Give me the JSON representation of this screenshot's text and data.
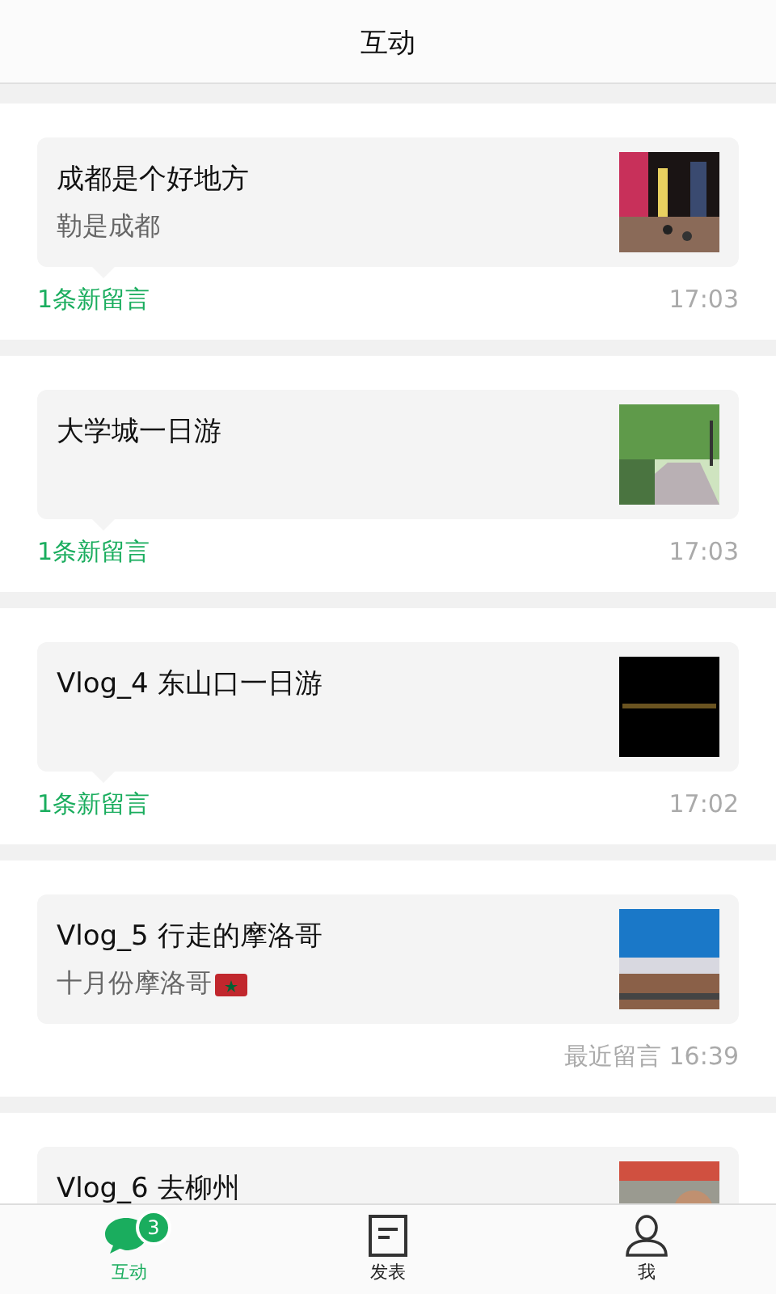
{
  "header": {
    "title": "互动"
  },
  "posts": [
    {
      "title": "成都是个好地方",
      "subtitle": "勒是成都",
      "flag": false,
      "new_comments": "1条新留言",
      "time": "17:03"
    },
    {
      "title": "大学城一日游",
      "flag": false,
      "new_comments": "1条新留言",
      "time": "17:03"
    },
    {
      "title": "Vlog_4 东山口一日游",
      "flag": false,
      "new_comments": "1条新留言",
      "time": "17:02"
    },
    {
      "title": "Vlog_5 行走的摩洛哥",
      "subtitle": "十月份摩洛哥",
      "flag": true,
      "time": "最近留言 16:39"
    },
    {
      "title": "Vlog_6 去柳州",
      "flag": false
    }
  ],
  "tabs": [
    {
      "kind": "chat",
      "label": "互动",
      "selected": true,
      "badge": "3"
    },
    {
      "kind": "post",
      "label": "发表",
      "selected": false
    },
    {
      "kind": "me",
      "label": "我",
      "selected": false
    }
  ]
}
